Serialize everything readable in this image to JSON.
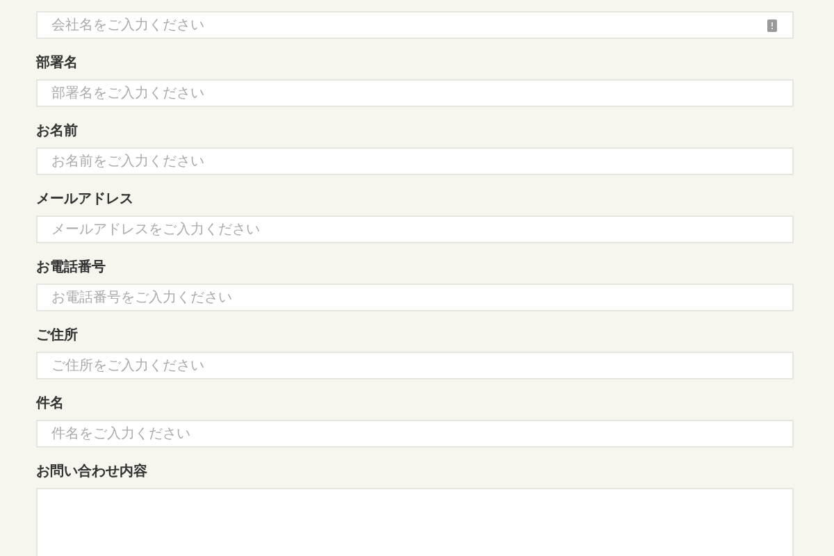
{
  "fields": [
    {
      "placeholder": "会社名をご入力ください",
      "kind": "text",
      "icon": true
    },
    {
      "label": "部署名",
      "placeholder": "部署名をご入力ください",
      "kind": "text",
      "icon": false
    },
    {
      "label": "お名前",
      "placeholder": "お名前をご入力ください",
      "kind": "text",
      "icon": false
    },
    {
      "label": "メールアドレス",
      "placeholder": "メールアドレスをご入力ください",
      "kind": "text",
      "icon": false
    },
    {
      "label": "お電話番号",
      "placeholder": "お電話番号をご入力ください",
      "kind": "text",
      "icon": false
    },
    {
      "label": "ご住所",
      "placeholder": "ご住所をご入力ください",
      "kind": "text",
      "icon": false
    },
    {
      "label": "件名",
      "placeholder": "件名をご入力ください",
      "kind": "text",
      "icon": false
    },
    {
      "label": "お問い合わせ内容",
      "kind": "textarea",
      "icon": false
    }
  ]
}
